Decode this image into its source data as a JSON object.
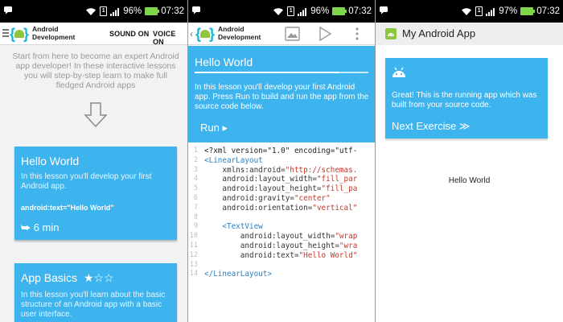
{
  "status_bars": [
    {
      "battery": "96%",
      "time": "07:32",
      "sim": "1"
    },
    {
      "battery": "96%",
      "time": "07:32",
      "sim": "1"
    },
    {
      "battery": "97%",
      "time": "07:32",
      "sim": "1"
    }
  ],
  "panel1": {
    "app_title_line1": "Android",
    "app_title_line2": "Development",
    "sound_on_label": "SOUND ON",
    "voice_on_label": "VOICE ON",
    "intro_text": "Start from here to become an expert Android app developer! In these interactive lessons you will step-by-step learn to make full fledged Android apps",
    "cards": [
      {
        "title": "Hello World",
        "description": "In this lesson you'll develop your first Android app.",
        "code": "android:text=\"Hello World\"",
        "duration": "6 min"
      },
      {
        "title": "App Basics",
        "stars": "★☆☆",
        "description": "In this lesson you'll learn about the basic structure of an Android app with a basic user interface."
      }
    ]
  },
  "panel2": {
    "app_title_line1": "Android",
    "app_title_line2": "Development",
    "lesson_title": "Hello World",
    "progress": 0.83,
    "lesson_description": "In this lesson you'll develop your first Android app. Press Run to build and run the app from the source code below.",
    "run_label": "Run ▸",
    "code_lines": [
      {
        "n": "1",
        "parts": [
          {
            "c": "plain",
            "t": "<?xml version=\"1.0\" encoding=\"utf-"
          }
        ]
      },
      {
        "n": "2",
        "parts": [
          {
            "c": "tag",
            "t": "<LinearLayout"
          }
        ]
      },
      {
        "n": "3",
        "parts": [
          {
            "c": "attr",
            "t": "    xmlns:android="
          },
          {
            "c": "val",
            "t": "\"http://schemas."
          }
        ]
      },
      {
        "n": "4",
        "parts": [
          {
            "c": "attr",
            "t": "    android:layout_width="
          },
          {
            "c": "val",
            "t": "\"fill_par"
          }
        ]
      },
      {
        "n": "5",
        "parts": [
          {
            "c": "attr",
            "t": "    android:layout_height="
          },
          {
            "c": "val",
            "t": "\"fill_pa"
          }
        ]
      },
      {
        "n": "6",
        "parts": [
          {
            "c": "attr",
            "t": "    android:gravity="
          },
          {
            "c": "val",
            "t": "\"center\""
          }
        ]
      },
      {
        "n": "7",
        "parts": [
          {
            "c": "attr",
            "t": "    android:orientation="
          },
          {
            "c": "val",
            "t": "\"vertical\""
          }
        ]
      },
      {
        "n": "8",
        "parts": []
      },
      {
        "n": "9",
        "parts": [
          {
            "c": "tag",
            "t": "    <TextView"
          }
        ]
      },
      {
        "n": "10",
        "parts": [
          {
            "c": "attr",
            "t": "        android:layout_width="
          },
          {
            "c": "val",
            "t": "\"wrap"
          }
        ]
      },
      {
        "n": "11",
        "parts": [
          {
            "c": "attr",
            "t": "        android:layout_height="
          },
          {
            "c": "val",
            "t": "\"wra"
          }
        ]
      },
      {
        "n": "12",
        "parts": [
          {
            "c": "attr",
            "t": "        android:text="
          },
          {
            "c": "val",
            "t": "\"Hello World\""
          }
        ]
      },
      {
        "n": "13",
        "parts": []
      },
      {
        "n": "14",
        "parts": [
          {
            "c": "tag",
            "t": "</LinearLayout>"
          }
        ]
      }
    ]
  },
  "panel3": {
    "app_title": "My Android App",
    "exercise_description": "Great! This is the running app which was built from your source code.",
    "next_label": "Next Exercise ≫",
    "hello_text": "Hello World"
  },
  "colors": {
    "card_blue": "#3db4ee",
    "battery_green": "#7fd44a",
    "droid_green": "#8ec63f"
  }
}
